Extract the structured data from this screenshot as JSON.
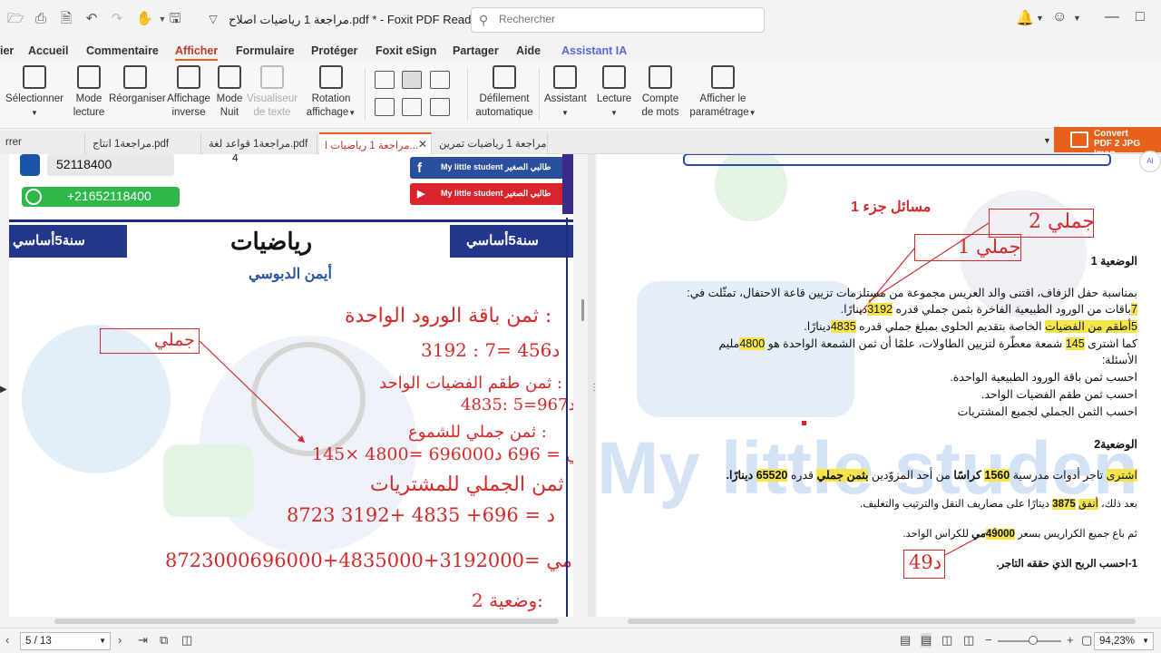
{
  "window": {
    "title": "مراجعة 1 رياضيات اصلاح.pdf * - Foxit PDF Reader",
    "search_placeholder": "Rechercher"
  },
  "menu": [
    "ier",
    "Accueil",
    "Commentaire",
    "Afficher",
    "Formulaire",
    "Protéger",
    "Foxit eSign",
    "Partager",
    "Aide",
    "Assistant IA"
  ],
  "ribbon": {
    "select": "Sélectionner",
    "mode_lecture_1": "Mode",
    "mode_lecture_2": "lecture",
    "reorganiser": "Réorganiser",
    "affichage_1": "Affichage",
    "affichage_2": "inverse",
    "mode_nuit_1": "Mode",
    "mode_nuit_2": "Nuit",
    "visualiseur_1": "Visualiseur",
    "visualiseur_2": "de texte",
    "rotation_1": "Rotation",
    "rotation_2": "affichage",
    "defilement_1": "Défilement",
    "defilement_2": "automatique",
    "assistant": "Assistant",
    "lecture": "Lecture",
    "compte_1": "Compte",
    "compte_2": "de mots",
    "afficher_1": "Afficher le",
    "afficher_2": "paramétrage"
  },
  "tabs": [
    "rrer",
    "مراجعة1 انتاج.pdf",
    "مراجعة1 قواعد لغة.pdf",
    "مراجعة 1 رياضيات ا...",
    "مراجعة 1 رياضيات تمرين..."
  ],
  "convert": {
    "line1": "Convert",
    "line2": "PDF 2 JPG Imag"
  },
  "left_page": {
    "page_num": "4",
    "phone": "52118400",
    "whatsapp": "+21652118400",
    "fb": "My little student طالبي الصغير",
    "yt": "My little student طالبي الصغير",
    "band_left": "سنة5أساسي",
    "band_right": "سنة5أساسي",
    "band_title": "رياضيات",
    "author": "أيمن الدبوسي",
    "wm": "My little",
    "ann": {
      "l1": "ثمن باقة الورود الواحدة :",
      "jamli": "جملي",
      "l2": "3192 : 7=  456د",
      "l3": "ثمن طقم الفضيات الواحد :",
      "l4": "4835: 5=967د",
      "l5": "ثمن جملي للشموع :",
      "l6": "145× 4800=  696000مي = 696 د",
      "l7": "ثمن الجملي للمشتريات",
      "l8": "8723 د    = 696+ 4835 +3192",
      "l9": "8723000مي =3192000+4835000+696000",
      "l10": "وضعية 2:"
    }
  },
  "right_page": {
    "heading": "مسائل جزء 1",
    "jamli2": "جملي 2",
    "jamli1": "جملي 1",
    "s1_title": "الوضعية 1",
    "s1_l1": "بمناسبة حفل الزفاف، اقتنى والد العريس مجموعة من مستلزمات تزيين قاعة الاحتفال، تمثّلت في:",
    "s1_l2a": "7",
    "s1_l2b": "باقات من الورود الطبيعية الفاخرة بثمن جملي قدره ",
    "s1_l2c": "3192",
    "s1_l2d": "دينارًا.",
    "s1_l3a": "5",
    "s1_l3b": "أطقم من الفضيات",
    "s1_l3c": " الخاصة بتقديم الحلوى بمبلغ جملي قدره ",
    "s1_l3d": "4835",
    "s1_l3e": "دينارًا.",
    "s1_l4a": "كما اشترى ",
    "s1_l4b": "145",
    "s1_l4c": " شمعة معطّرة لتزيين الطاولات، علمًا أن ثمن الشمعة الواحدة هو ",
    "s1_l4d": "4800",
    "s1_l4e": "مليم",
    "s1_q": "الأسئلة:",
    "s1_q1": "احسب ثمن باقة الورود الطبيعية الواحدة.",
    "s1_q2": "احسب ثمن طقم الفضيات الواحد.",
    "s1_q3": "احسب الثمن الجملي لجميع المشتريات",
    "s2_title": "الوضعية2",
    "s2_l1a": "اشترى",
    "s2_l1b": " تاجر أدوات مدرسية ",
    "s2_l1c": "1560",
    "s2_l1d": " كراسًا",
    "s2_l1e": " من أحد المزوّدين ",
    "s2_l1f": "بثمن جملي",
    "s2_l1g": " قدره ",
    "s2_l1h": "65520",
    "s2_l1i": " دينارًا.",
    "s2_l2a": "بعد ذلك، ",
    "s2_l2b": "أنفق",
    "s2_l2c": " ",
    "s2_l2d": "3875",
    "s2_l2e": " دينارًا على مصاريف النقل والترتيب والتغليف.",
    "s2_l3a": "ثم باع جميع الكراريس بسعر ",
    "s2_l3b": "49000",
    "s2_l3c": "مي",
    "s2_l3d": " للكراس الواحد.",
    "s2_q1": "1-احسب الربح الذي حققه التاجر.",
    "ann49": "49د",
    "wm": "My little studen"
  },
  "status": {
    "page": "5 / 13",
    "zoom": "94,23%"
  }
}
